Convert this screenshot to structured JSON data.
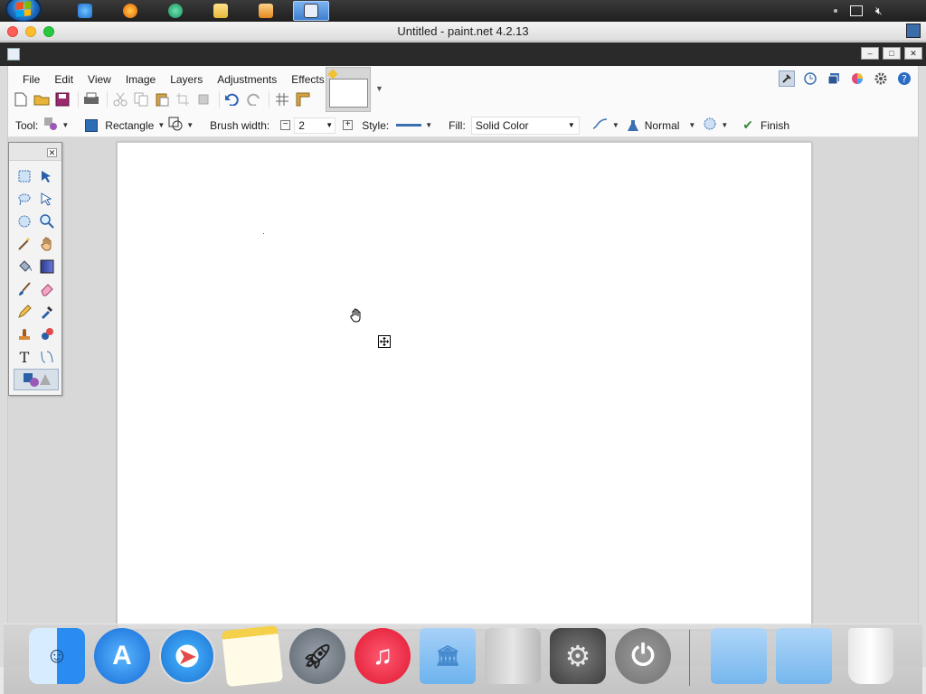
{
  "window": {
    "title": "Untitled - paint.net 4.2.13"
  },
  "menu": {
    "items": [
      "File",
      "Edit",
      "View",
      "Image",
      "Layers",
      "Adjustments",
      "Effects"
    ]
  },
  "toolbar": {
    "tool_label": "Tool:",
    "shape_label": "Rectangle",
    "brush_width_label": "Brush width:",
    "brush_width_value": "2",
    "style_label": "Style:",
    "fill_label": "Fill:",
    "fill_value": "Solid Color",
    "blend_mode": "Normal",
    "finish_label": "Finish"
  },
  "colors": {
    "accent": "#2d6db5",
    "canvas": "#ffffff",
    "taskbar": "#262626"
  },
  "icons": {
    "tools": [
      "rectangle-select-icon",
      "move-selection-icon",
      "lasso-select-icon",
      "move-selected-icon",
      "ellipse-select-icon",
      "zoom-icon",
      "magic-wand-icon",
      "pan-icon",
      "paint-bucket-icon",
      "gradient-icon",
      "paintbrush-icon",
      "eraser-icon",
      "pencil-icon",
      "color-picker-icon",
      "clone-stamp-icon",
      "recolor-icon",
      "text-icon",
      "line-curve-icon",
      "shapes-icon"
    ],
    "dock": [
      "finder-icon",
      "app-store-icon",
      "safari-icon",
      "notes-icon",
      "launchpad-icon",
      "music-icon",
      "library-folder-icon",
      "mac-pro-icon",
      "system-preferences-icon",
      "power-icon",
      "folder-icon",
      "documents-folder-icon",
      "trash-icon"
    ]
  }
}
